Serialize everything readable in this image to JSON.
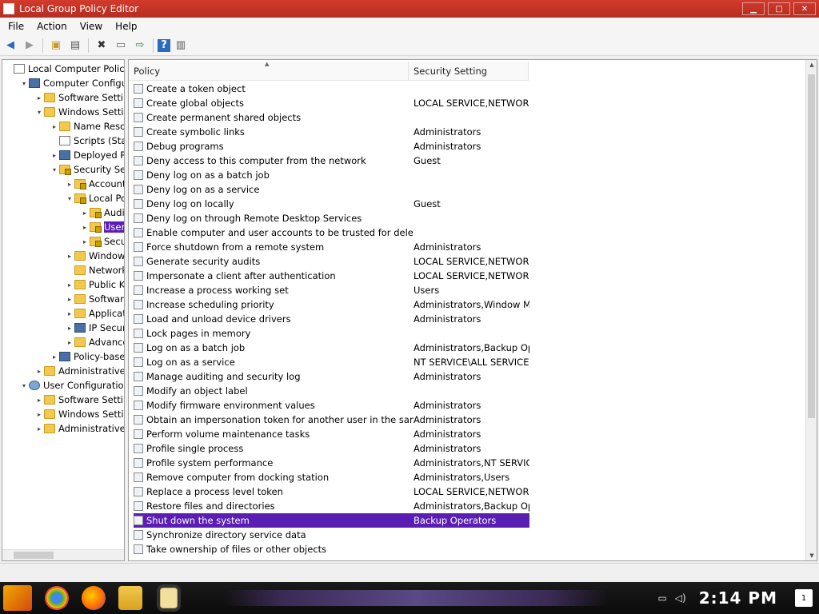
{
  "window": {
    "title": "Local Group Policy Editor"
  },
  "menu": [
    "File",
    "Action",
    "View",
    "Help"
  ],
  "tree": [
    {
      "label": "Local Computer Policy",
      "level": 0,
      "arrow": "",
      "icon": "doc"
    },
    {
      "label": "Computer Configuratio",
      "level": 1,
      "arrow": "▾",
      "icon": "pc"
    },
    {
      "label": "Software Settings",
      "level": 2,
      "arrow": "▸",
      "icon": "folder"
    },
    {
      "label": "Windows Settings",
      "level": 2,
      "arrow": "▾",
      "icon": "folder"
    },
    {
      "label": "Name Resolution",
      "level": 3,
      "arrow": "▸",
      "icon": "folder"
    },
    {
      "label": "Scripts (Startup",
      "level": 3,
      "arrow": "",
      "icon": "doc"
    },
    {
      "label": "Deployed Printers",
      "level": 3,
      "arrow": "▸",
      "icon": "pc"
    },
    {
      "label": "Security Settings",
      "level": 3,
      "arrow": "▾",
      "icon": "lockfolder"
    },
    {
      "label": "Account Policies",
      "level": 4,
      "arrow": "▸",
      "icon": "lockfolder"
    },
    {
      "label": "Local Policies",
      "level": 4,
      "arrow": "▾",
      "icon": "lockfolder"
    },
    {
      "label": "Audit Policy",
      "level": 5,
      "arrow": "▸",
      "icon": "lockfolder"
    },
    {
      "label": "User Rights",
      "level": 5,
      "arrow": "▸",
      "icon": "lockfolder",
      "selected": true
    },
    {
      "label": "Security Options",
      "level": 5,
      "arrow": "▸",
      "icon": "lockfolder"
    },
    {
      "label": "Windows Firewall",
      "level": 4,
      "arrow": "▸",
      "icon": "folder"
    },
    {
      "label": "Network List",
      "level": 4,
      "arrow": "",
      "icon": "folder"
    },
    {
      "label": "Public Key",
      "level": 4,
      "arrow": "▸",
      "icon": "folder"
    },
    {
      "label": "Software Restriction",
      "level": 4,
      "arrow": "▸",
      "icon": "folder"
    },
    {
      "label": "Application Control",
      "level": 4,
      "arrow": "▸",
      "icon": "folder"
    },
    {
      "label": "IP Security",
      "level": 4,
      "arrow": "▸",
      "icon": "pc"
    },
    {
      "label": "Advanced Audit",
      "level": 4,
      "arrow": "▸",
      "icon": "folder"
    },
    {
      "label": "Policy-based QoS",
      "level": 3,
      "arrow": "▸",
      "icon": "pc"
    },
    {
      "label": "Administrative Templates",
      "level": 2,
      "arrow": "▸",
      "icon": "folder"
    },
    {
      "label": "User Configuration",
      "level": 1,
      "arrow": "▾",
      "icon": "user"
    },
    {
      "label": "Software Settings",
      "level": 2,
      "arrow": "▸",
      "icon": "folder"
    },
    {
      "label": "Windows Settings",
      "level": 2,
      "arrow": "▸",
      "icon": "folder"
    },
    {
      "label": "Administrative Templates",
      "level": 2,
      "arrow": "▸",
      "icon": "folder"
    }
  ],
  "list": {
    "columns": [
      "Policy",
      "Security Setting"
    ],
    "rows": [
      {
        "policy": "Create a token object",
        "setting": ""
      },
      {
        "policy": "Create global objects",
        "setting": "LOCAL SERVICE,NETWORK..."
      },
      {
        "policy": "Create permanent shared objects",
        "setting": ""
      },
      {
        "policy": "Create symbolic links",
        "setting": "Administrators"
      },
      {
        "policy": "Debug programs",
        "setting": "Administrators"
      },
      {
        "policy": "Deny access to this computer from the network",
        "setting": "Guest"
      },
      {
        "policy": "Deny log on as a batch job",
        "setting": ""
      },
      {
        "policy": "Deny log on as a service",
        "setting": ""
      },
      {
        "policy": "Deny log on locally",
        "setting": "Guest"
      },
      {
        "policy": "Deny log on through Remote Desktop Services",
        "setting": ""
      },
      {
        "policy": "Enable computer and user accounts to be trusted for delegation",
        "setting": ""
      },
      {
        "policy": "Force shutdown from a remote system",
        "setting": "Administrators"
      },
      {
        "policy": "Generate security audits",
        "setting": "LOCAL SERVICE,NETWORK..."
      },
      {
        "policy": "Impersonate a client after authentication",
        "setting": "LOCAL SERVICE,NETWORK..."
      },
      {
        "policy": "Increase a process working set",
        "setting": "Users"
      },
      {
        "policy": "Increase scheduling priority",
        "setting": "Administrators,Window Ma..."
      },
      {
        "policy": "Load and unload device drivers",
        "setting": "Administrators"
      },
      {
        "policy": "Lock pages in memory",
        "setting": ""
      },
      {
        "policy": "Log on as a batch job",
        "setting": "Administrators,Backup Op..."
      },
      {
        "policy": "Log on as a service",
        "setting": "NT SERVICE\\ALL SERVICES"
      },
      {
        "policy": "Manage auditing and security log",
        "setting": "Administrators"
      },
      {
        "policy": "Modify an object label",
        "setting": ""
      },
      {
        "policy": "Modify firmware environment values",
        "setting": "Administrators"
      },
      {
        "policy": "Obtain an impersonation token for another user in the same session",
        "setting": "Administrators"
      },
      {
        "policy": "Perform volume maintenance tasks",
        "setting": "Administrators"
      },
      {
        "policy": "Profile single process",
        "setting": "Administrators"
      },
      {
        "policy": "Profile system performance",
        "setting": "Administrators,NT SERVIC..."
      },
      {
        "policy": "Remove computer from docking station",
        "setting": "Administrators,Users"
      },
      {
        "policy": "Replace a process level token",
        "setting": "LOCAL SERVICE,NETWORK..."
      },
      {
        "policy": "Restore files and directories",
        "setting": "Administrators,Backup Op..."
      },
      {
        "policy": "Shut down the system",
        "setting": "Backup Operators",
        "selected": true
      },
      {
        "policy": "Synchronize directory service data",
        "setting": ""
      },
      {
        "policy": "Take ownership of files or other objects",
        "setting": ""
      }
    ]
  },
  "taskbar": {
    "clock": "2:14 PM",
    "notifications": "1"
  },
  "colors": {
    "titlebar": "#c0392b",
    "selection": "#5b1eb4"
  }
}
